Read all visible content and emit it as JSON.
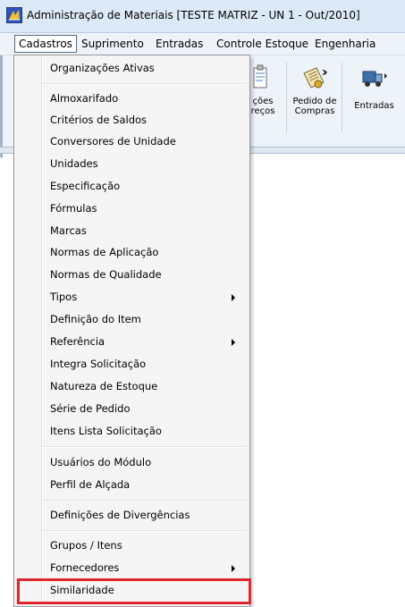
{
  "window": {
    "title": "Administração de Materiais [TESTE MATRIZ - UN 1 - Out/2010]"
  },
  "menubar": {
    "items": [
      "Cadastros",
      "Suprimento",
      "Entradas",
      "Controle Estoque",
      "Engenharia"
    ],
    "active": "Cadastros"
  },
  "toolbar": {
    "buttons": [
      {
        "label_line1": "ções",
        "label_line2": "reços",
        "icon": "clipboard-icon"
      },
      {
        "label_line1": "Pedido de",
        "label_line2": "Compras",
        "icon": "purchase-order-icon"
      },
      {
        "label_line1": "Entradas",
        "label_line2": "",
        "icon": "truck-icon"
      }
    ]
  },
  "dropdown": {
    "items": [
      {
        "label": "Organizações Ativas",
        "submenu": false
      },
      {
        "label": "Almoxarifado",
        "submenu": false
      },
      {
        "label": "Critérios de Saldos",
        "submenu": false
      },
      {
        "label": "Conversores de Unidade",
        "submenu": false
      },
      {
        "label": "Unidades",
        "submenu": false
      },
      {
        "label": "Especificação",
        "submenu": false
      },
      {
        "label": "Fórmulas",
        "submenu": false
      },
      {
        "label": "Marcas",
        "submenu": false
      },
      {
        "label": "Normas de Aplicação",
        "submenu": false
      },
      {
        "label": "Normas de Qualidade",
        "submenu": false
      },
      {
        "label": "Tipos",
        "submenu": true
      },
      {
        "label": "Definição do Item",
        "submenu": false
      },
      {
        "label": "Referência",
        "submenu": true
      },
      {
        "label": "Integra Solicitação",
        "submenu": false
      },
      {
        "label": "Natureza de Estoque",
        "submenu": false
      },
      {
        "label": "Série de Pedido",
        "submenu": false
      },
      {
        "label": "Itens Lista Solicitação",
        "submenu": false
      },
      {
        "label": "Usuários do Módulo",
        "submenu": false
      },
      {
        "label": "Perfil de Alçada",
        "submenu": false
      },
      {
        "label": "Definições de Divergências",
        "submenu": false
      },
      {
        "label": "Grupos / Itens",
        "submenu": false
      },
      {
        "label": "Fornecedores",
        "submenu": true
      },
      {
        "label": "Similaridade",
        "submenu": false,
        "highlighted": true
      }
    ]
  },
  "colors": {
    "highlight": "#e0262f",
    "menu_bg": "#f5f5f5",
    "title_bg": "#dce9f6"
  }
}
